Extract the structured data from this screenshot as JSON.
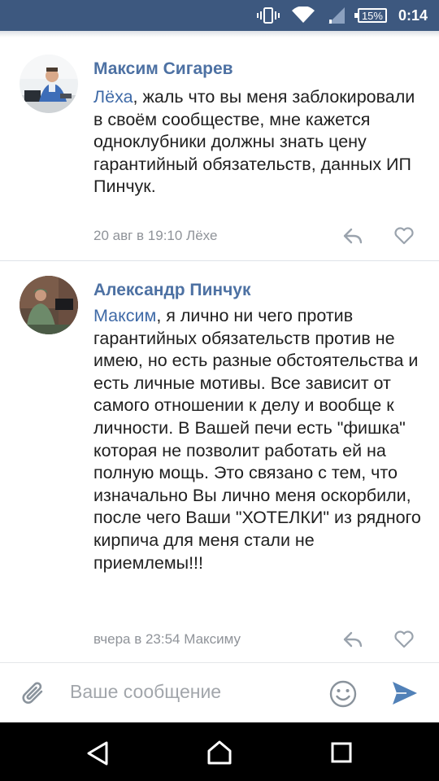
{
  "status_bar": {
    "battery": "15%",
    "time": "0:14"
  },
  "comments": [
    {
      "author": "Максим Сигарев",
      "mention": "Лёха",
      "text": ", жаль что вы меня заблокировали в своём сообществе, мне кажется одноклубники должны знать цену гарантийный обязательств, данных ИП Пинчук.",
      "meta": "20 авг в 19:10 Лёхе"
    },
    {
      "author": "Александр Пинчук",
      "mention": "Максим",
      "text": ", я лично ни чего против гарантийных обязательств против не имею, но есть разные обстоятельства и есть личные мотивы. Все зависит от самого отношении к делу и вообще к личности. В Вашей печи есть \"фишка\" которая не позволит работать ей на полную мощь. Это связано с тем, что изначально Вы лично меня оскорбили, после чего Ваши \"ХОТЕЛКИ\" из рядного кирпича для меня стали не приемлемы!!!",
      "meta": "вчера в 23:54 Максиму"
    }
  ],
  "composer": {
    "placeholder": "Ваше сообщение"
  },
  "icons": {
    "attach": "paperclip-icon",
    "emoji": "smiley-icon",
    "send": "send-icon",
    "reply": "reply-icon",
    "like": "heart-icon",
    "nav_back": "back-triangle-icon",
    "nav_home": "home-icon",
    "nav_recents": "recents-square-icon"
  },
  "colors": {
    "status_bar": "#3d587f",
    "author": "#4d71a3",
    "link": "#3f6aa7",
    "meta": "#8f9399",
    "send": "#5181b8"
  }
}
